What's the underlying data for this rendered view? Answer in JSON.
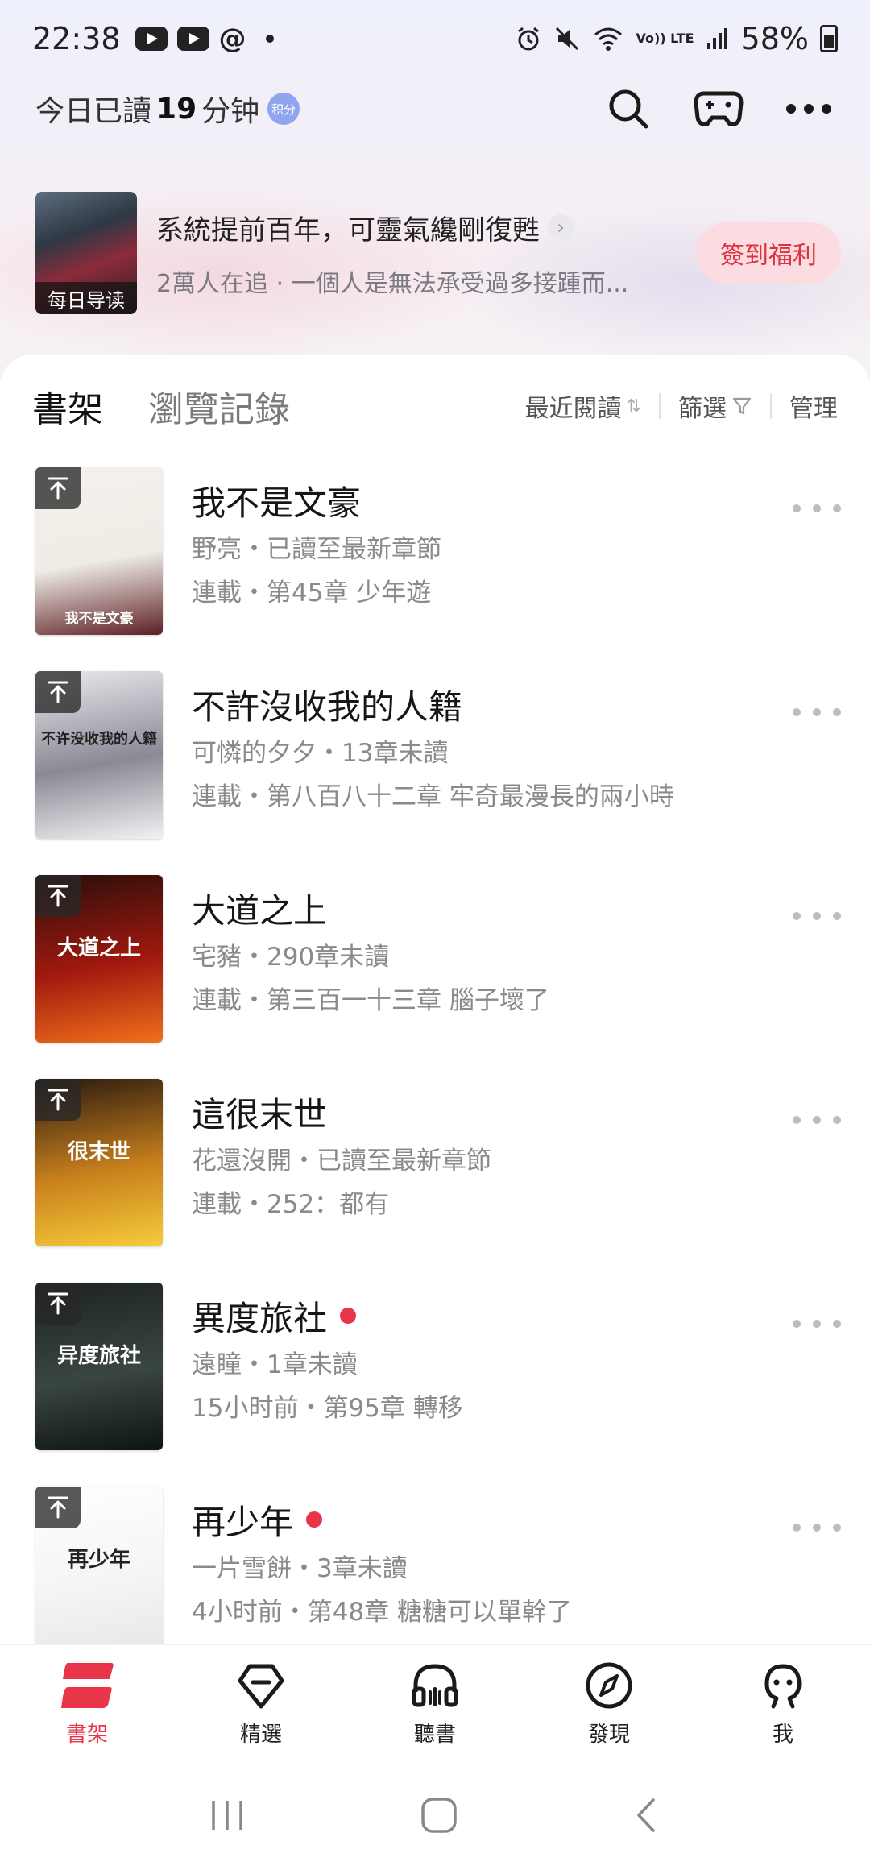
{
  "status_bar": {
    "time": "22:38",
    "battery": "58%",
    "volte": "Vo)) LTE",
    "threads_glyph": "@"
  },
  "header": {
    "read_prefix": "今日已讀",
    "read_minutes": "19",
    "read_suffix": "分钟",
    "points_badge": "积分",
    "icons": [
      "search-icon",
      "gamepad-icon",
      "more-icon"
    ]
  },
  "promo": {
    "cover_tag": "每日导读",
    "title": "系統提前百年，可靈氣纔剛復甦",
    "chevron": "›",
    "subtitle": "2萬人在追 · 一個人是無法承受過多接踵而...",
    "signin_button": "簽到福利"
  },
  "tabs": {
    "bookshelf": "書架",
    "history": "瀏覽記錄",
    "sort": "最近閱讀",
    "sort_icon": "⇅",
    "filter": "篩選",
    "manage": "管理"
  },
  "books": [
    {
      "title": "我不是文豪",
      "meta": "野亮・已讀至最新章節",
      "latest": "連載・第45章 少年遊",
      "new": false,
      "cover_text": "我不是文豪",
      "cover_colors": [
        "#f4f1ec",
        "#efece6",
        "#5c1f24"
      ]
    },
    {
      "title": "不許沒收我的人籍",
      "meta": "可憐的夕夕・13章未讀",
      "latest": "連載・第八百八十二章 牢奇最漫長的兩小時",
      "new": false,
      "cover_text": "不许没收我的人籍",
      "cover_colors": [
        "#e9e9ee",
        "#8a8a95",
        "#f2f2f4"
      ]
    },
    {
      "title": "大道之上",
      "meta": "宅豬・290章未讀",
      "latest": "連載・第三百一十三章 腦子壞了",
      "new": false,
      "cover_text": "大道之上",
      "cover_colors": [
        "#2b0e0a",
        "#a3190f",
        "#f0701a"
      ]
    },
    {
      "title": "這很末世",
      "meta": "花還沒開・已讀至最新章節",
      "latest": "連載・252：都有",
      "new": false,
      "cover_text": "很末世",
      "cover_colors": [
        "#2a1a10",
        "#c8801c",
        "#f6cc3a"
      ]
    },
    {
      "title": "異度旅社",
      "meta": "遠瞳・1章未讀",
      "latest": "15小时前・第95章 轉移",
      "new": true,
      "cover_text": "异度旅社",
      "cover_colors": [
        "#1c2420",
        "#3a4640",
        "#0e1411"
      ]
    },
    {
      "title": "再少年",
      "meta": "一片雪餅・3章未讀",
      "latest": "4小时前・第48章 糖糖可以單幹了",
      "new": true,
      "cover_text": "再少年",
      "cover_colors": [
        "#ffffff",
        "#f5f5f5",
        "#e7e7e7"
      ]
    }
  ],
  "bottom_nav": [
    {
      "label": "書架",
      "icon": "bookshelf-icon",
      "active": true
    },
    {
      "label": "精選",
      "icon": "diamond-icon",
      "active": false
    },
    {
      "label": "聽書",
      "icon": "headphones-icon",
      "active": false
    },
    {
      "label": "發現",
      "icon": "compass-icon",
      "active": false
    },
    {
      "label": "我",
      "icon": "profile-icon",
      "active": false
    }
  ],
  "colors": {
    "accent": "#e8354a",
    "signin_bg": "#fbdde1",
    "text_secondary": "#8a8a8a"
  }
}
